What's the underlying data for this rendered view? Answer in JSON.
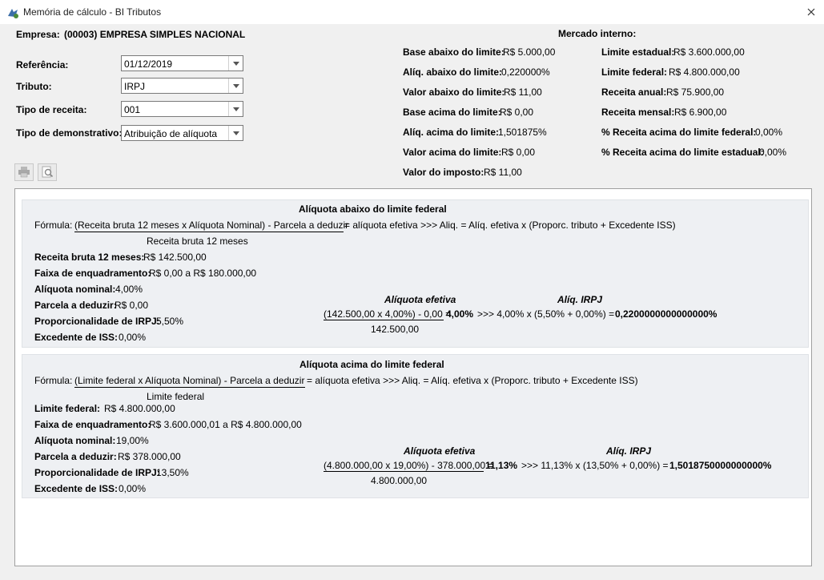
{
  "window": {
    "title": "Memória de cálculo - BI Tributos"
  },
  "empresa": {
    "label": "Empresa:",
    "value": "(00003) EMPRESA SIMPLES NACIONAL"
  },
  "form": {
    "referencia": {
      "label": "Referência:",
      "value": "01/12/2019"
    },
    "tributo": {
      "label": "Tributo:",
      "value": "IRPJ"
    },
    "tipo_receita": {
      "label": "Tipo de receita:",
      "value": "001"
    },
    "tipo_demonstrativo": {
      "label": "Tipo de demonstrativo:",
      "value": "Atribuição de alíquota"
    }
  },
  "mercado": {
    "header": "Mercado interno:",
    "left": [
      {
        "label": "Base abaixo do limite:",
        "value": "R$ 5.000,00"
      },
      {
        "label": "Alíq. abaixo do limite:",
        "value": "0,220000%"
      },
      {
        "label": "Valor abaixo do limite:",
        "value": "R$ 11,00"
      },
      {
        "label": "Base acima do limite:",
        "value": "R$ 0,00"
      },
      {
        "label": "Alíq. acima do limite:",
        "value": "1,501875%"
      },
      {
        "label": "Valor acima do limite:",
        "value": "R$ 0,00"
      },
      {
        "label": "Valor do imposto:",
        "value": "R$ 11,00"
      }
    ],
    "right": [
      {
        "label": "Limite estadual:",
        "value": "R$ 3.600.000,00"
      },
      {
        "label": "Limite federal:",
        "value": "R$ 4.800.000,00"
      },
      {
        "label": "Receita anual:",
        "value": "R$ 75.900,00"
      },
      {
        "label": "Receita mensal:",
        "value": "R$ 6.900,00"
      },
      {
        "label": "% Receita acima do limite federal:",
        "value": "0,00%"
      },
      {
        "label": "% Receita acima do limite estadual:",
        "value": "0,00%"
      }
    ]
  },
  "panel1": {
    "title": "Alíquota abaixo do limite federal",
    "formula_prefix": "Fórmula:",
    "formula_numerator": "(Receita bruta 12 meses x Alíquota Nominal) - Parcela a deduzir",
    "formula_suffix": "= alíquota efetiva   >>>   Aliq. = Alíq. efetiva x (Proporc. tributo + Excedente ISS)",
    "formula_denominator": "Receita bruta 12 meses",
    "fields": [
      {
        "label": "Receita bruta 12 meses:",
        "value": "R$ 142.500,00"
      },
      {
        "label": "Faixa de enquadramento:",
        "value": "R$ 0,00 a R$ 180.000,00"
      },
      {
        "label": "Alíquota nominal:",
        "value": "4,00%"
      },
      {
        "label": "Parcela a deduzir:",
        "value": "R$ 0,00"
      },
      {
        "label": "Proporcionalidade de IRPJ:",
        "value": "5,50%"
      },
      {
        "label": "Excedente de ISS:",
        "value": "0,00%"
      }
    ],
    "calc_title_left": "Alíquota efetiva",
    "calc_title_right": "Alíq. IRPJ",
    "calc_numerator": "(142.500,00 x 4,00%) - 0,00 =",
    "calc_result": "4,00%",
    "calc_middle": ">>> 4,00% x (5,50% + 0,00%) =",
    "calc_final": "0,2200000000000000%",
    "calc_denominator": "142.500,00"
  },
  "panel2": {
    "title": "Alíquota acima do limite federal",
    "formula_prefix": "Fórmula:",
    "formula_numerator": "(Limite federal x Alíquota Nominal) - Parcela a deduzir",
    "formula_suffix": "= alíquota efetiva >>> Aliq. = Alíq. efetiva x (Proporc. tributo + Excedente ISS)",
    "formula_denominator": "Limite federal",
    "fields": [
      {
        "label": "Limite federal:",
        "value": "R$ 4.800.000,00"
      },
      {
        "label": "Faixa de enquadramento:",
        "value": "R$ 3.600.000,01 a R$ 4.800.000,00"
      },
      {
        "label": "Alíquota nominal:",
        "value": "19,00%"
      },
      {
        "label": "Parcela a deduzir:",
        "value": "R$ 378.000,00"
      },
      {
        "label": "Proporcionalidade de IRPJ:",
        "value": "13,50%"
      },
      {
        "label": "Excedente de ISS:",
        "value": "0,00%"
      }
    ],
    "calc_title_left": "Alíquota efetiva",
    "calc_title_right": "Alíq. IRPJ",
    "calc_numerator": "(4.800.000,00 x 19,00%) - 378.000,00 =",
    "calc_result": "11,13%",
    "calc_middle": ">>> 11,13% x (13,50% + 0,00%) =",
    "calc_final": "1,5018750000000000%",
    "calc_denominator": "4.800.000,00"
  },
  "icons": {
    "app": "app-logo-icon",
    "close": "close-icon",
    "print": "printer-icon",
    "preview": "print-preview-icon",
    "dropdown": "chevron-down-icon"
  }
}
